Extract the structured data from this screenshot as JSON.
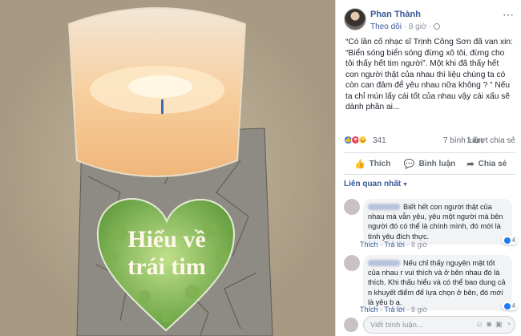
{
  "post": {
    "author": "Phan Thành",
    "follow_label": "Theo dõi",
    "time": "8 giờ",
    "text": "“Có lần cố nhạc sĩ Trịnh Công Sơn đã van xin:\n“Biển sóng biển sóng đừng xô tôi, đừng cho tôi thấy hết tim người”. Một khi đã thấy hết con người thật của nhau thì liệu chúng ta có còn can đảm để yêu nhau nữa không ? ” Nếu ta chỉ mún lấy cái tốt của nhau vậy cái xấu sẽ dành phần ai...",
    "reaction_count": "341",
    "comment_count": "7 bình luận",
    "share_count": "1 lượt chia sẻ"
  },
  "photo": {
    "heart_text_line1": "Hiểu về",
    "heart_text_line2": "trái tim"
  },
  "actions": {
    "like": "Thích",
    "comment": "Bình luận",
    "share": "Chia sẻ"
  },
  "sort_label": "Liên quan nhất",
  "comments": [
    {
      "text": "Biết hết con người thật của nhau mà vẫn yêu, yêu một người mà bên người đó có thể là chính mình, đó mới là tình yêu đích thực.",
      "like_label": "Thích",
      "reply_label": "Trả lời",
      "time": "8 giờ",
      "likes": "4"
    },
    {
      "text": "Nếu chỉ thấy nguyên mặt tốt của nhau r vui thích và ở bên nhau đó là thích. Khi thấu hiểu và có thể bao dung cả n khuyết điểm để lựa chọn ở bên, đó mới là yêu b ạ.",
      "like_label": "Thích",
      "reply_label": "Trả lời",
      "time": "8 giờ",
      "likes": "4"
    }
  ],
  "comment_input": {
    "placeholder": "Viết bình luận..."
  },
  "colors": {
    "link": "#385898",
    "like_blue": "#2078f4",
    "love_red": "#f33e58",
    "haha_yellow": "#fbd04b"
  }
}
